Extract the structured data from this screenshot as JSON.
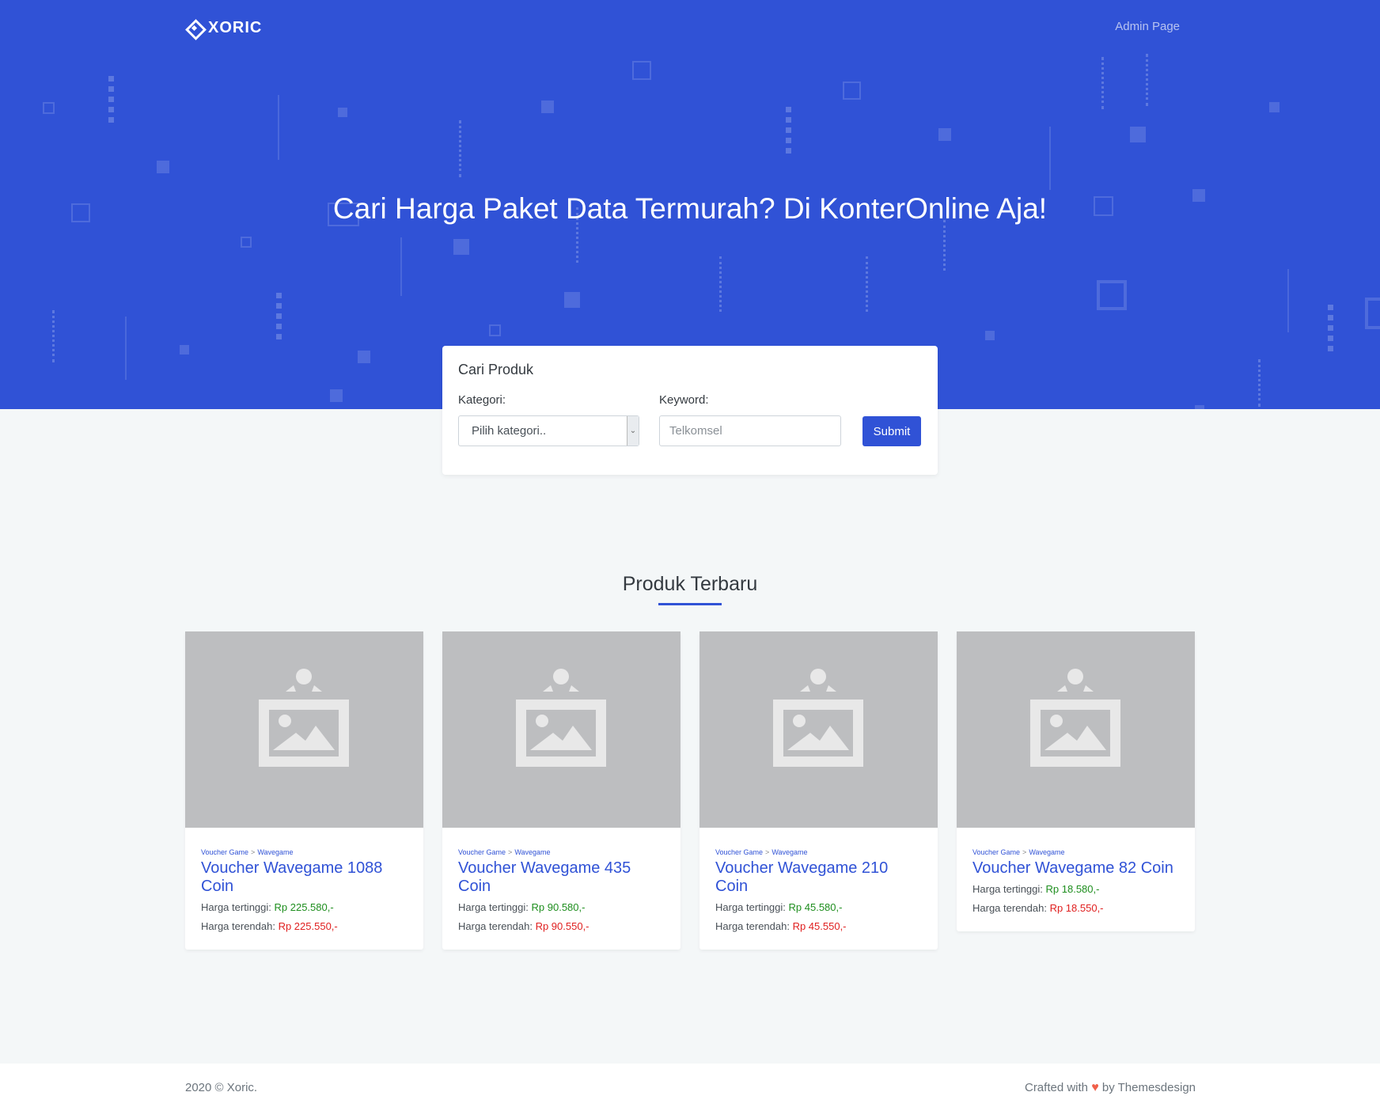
{
  "navbar": {
    "brand": "XORIC",
    "admin_link": "Admin Page"
  },
  "hero": {
    "title": "Cari Harga Paket Data Termurah? Di KonterOnline Aja!"
  },
  "search": {
    "title": "Cari Produk",
    "category_label": "Kategori:",
    "category_value": "Pilih kategori..",
    "keyword_label": "Keyword:",
    "keyword_placeholder": "Telkomsel",
    "submit_label": "Submit"
  },
  "section": {
    "title": "Produk Terbaru"
  },
  "products": [
    {
      "crumb1": "Voucher Game",
      "crumb2": "Wavegame",
      "sep": ">",
      "title": "Voucher Wavegame 1088 Coin",
      "high_label": "Harga tertinggi:",
      "high_value": "Rp 225.580,-",
      "low_label": "Harga terendah:",
      "low_value": "Rp 225.550,-"
    },
    {
      "crumb1": "Voucher Game",
      "crumb2": "Wavegame",
      "sep": ">",
      "title": "Voucher Wavegame 435 Coin",
      "high_label": "Harga tertinggi:",
      "high_value": "Rp 90.580,-",
      "low_label": "Harga terendah:",
      "low_value": "Rp 90.550,-"
    },
    {
      "crumb1": "Voucher Game",
      "crumb2": "Wavegame",
      "sep": ">",
      "title": "Voucher Wavegame 210 Coin",
      "high_label": "Harga tertinggi:",
      "high_value": "Rp 45.580,-",
      "low_label": "Harga terendah:",
      "low_value": "Rp 45.550,-"
    },
    {
      "crumb1": "Voucher Game",
      "crumb2": "Wavegame",
      "sep": ">",
      "title": "Voucher Wavegame 82 Coin",
      "high_label": "Harga tertinggi:",
      "high_value": "Rp 18.580,-",
      "low_label": "Harga terendah:",
      "low_value": "Rp 18.550,-"
    }
  ],
  "footer": {
    "copyright": "2020 © Xoric.",
    "crafted_prefix": "Crafted with",
    "crafted_suffix": "by Themesdesign"
  },
  "colors": {
    "primary": "#3052d6",
    "price_high": "#1e8e1e",
    "price_low": "#e02020",
    "heart": "#f0604a"
  },
  "icons": {
    "brand": "xoric-logo-icon",
    "select": "chevron-down-icon",
    "product_image": "image-placeholder-icon",
    "heart": "heart-icon"
  }
}
